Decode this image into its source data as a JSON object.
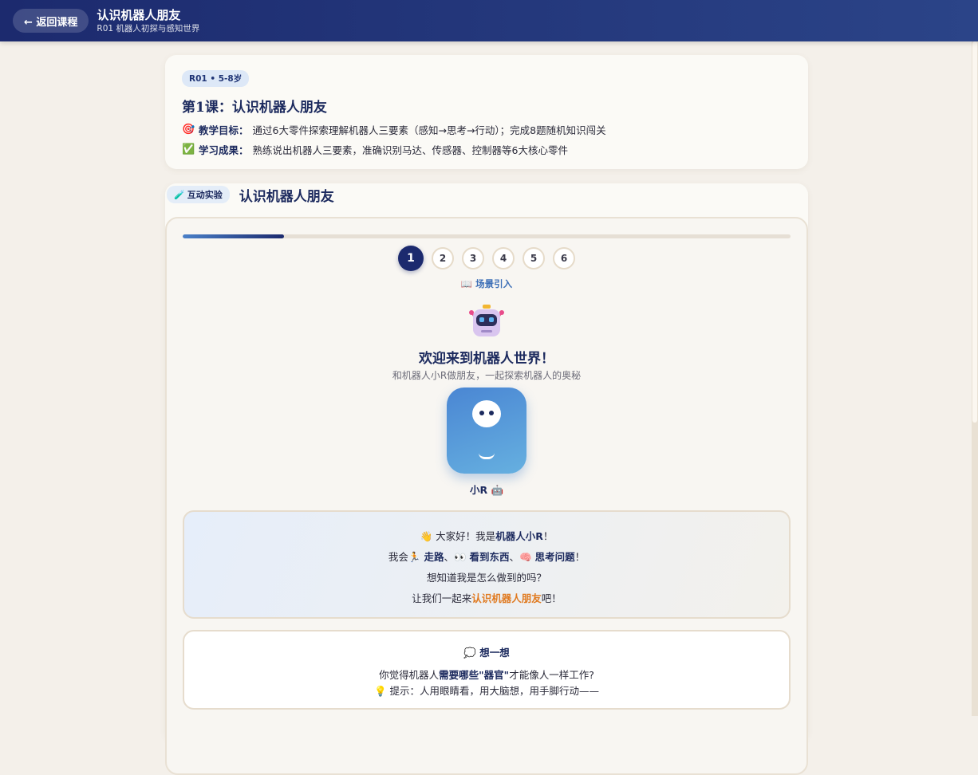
{
  "header": {
    "back_label": "← 返回课程",
    "title": "认识机器人朋友",
    "subtitle": "R01 机器人初探与感知世界"
  },
  "info": {
    "badge": "R01 • 5-8岁",
    "lesson_title": "第1课：认识机器人朋友",
    "goal_label": "教学目标：",
    "goal_text": "通过6大零件探索理解机器人三要素（感知→思考→行动）；完成8题随机知识闯关",
    "outcome_label": "学习成果：",
    "outcome_text": "熟练说出机器人三要素，准确识别马达、传感器、控制器等6大核心零件"
  },
  "lab": {
    "tag": "互动实验",
    "title": "认识机器人朋友",
    "progress": 0.1667,
    "steps": [
      "1",
      "2",
      "3",
      "4",
      "5",
      "6"
    ],
    "active_step": 1,
    "scene_label": "📖 场景引入",
    "welcome": "欢迎来到机器人世界！",
    "welcome_sub": "和机器人小R做朋友，一起探索机器人的奥秘",
    "avatar_name": "小R 🤖",
    "speech": {
      "l1_a": "👋 大家好！我是",
      "l1_b": "机器人小R",
      "l1_c": "！",
      "l2_a": "我会🏃",
      "l2_b": "走路",
      "l2_c": "、👀",
      "l2_d": "看到东西",
      "l2_e": "、🧠",
      "l2_f": "思考问题",
      "l2_g": "！",
      "l3": "想知道我是怎么做到的吗？",
      "l4_a": "让我们一起来",
      "l4_b": "认识机器人朋友",
      "l4_c": "吧！"
    },
    "think": {
      "heading": "💭 想一想",
      "q_a": "你觉得机器人",
      "q_b": "需要哪些\"器官\"",
      "q_c": "才能像人一样工作?",
      "hint": "💡 提示：人用眼睛看，用大脑想，用手脚行动——"
    }
  }
}
